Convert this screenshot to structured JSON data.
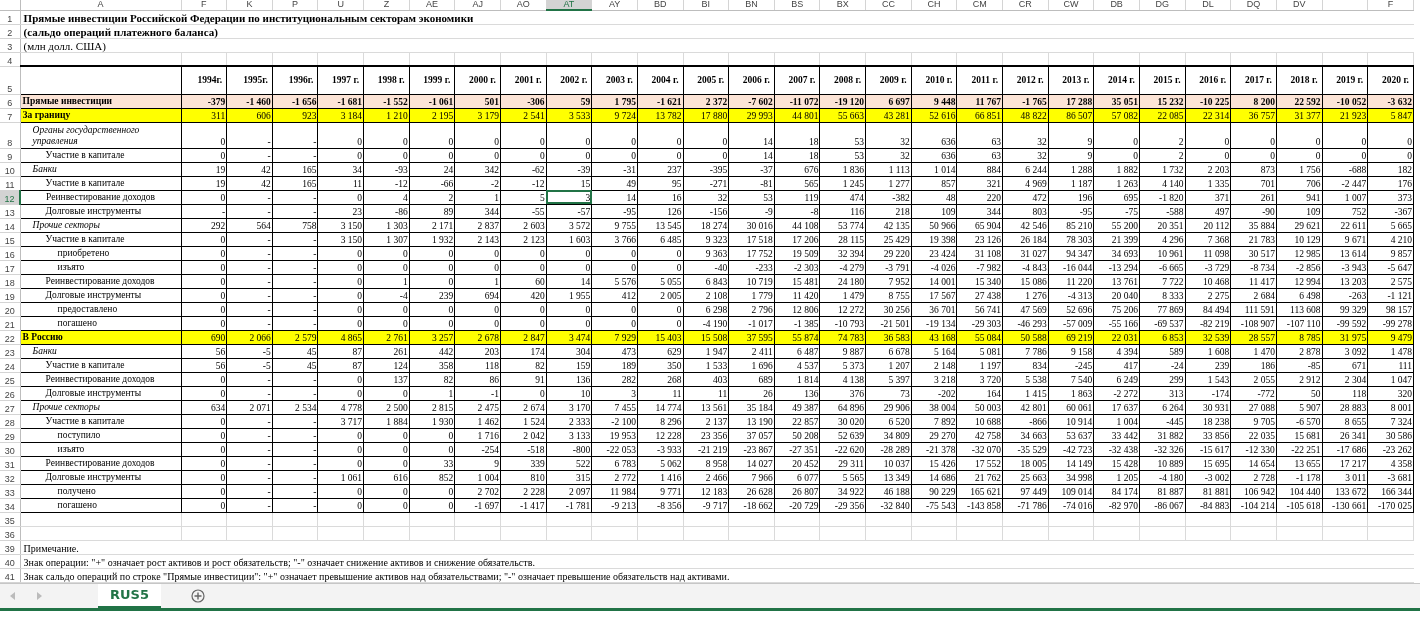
{
  "label_column_letter": "A",
  "columns": [
    {
      "letter": "F",
      "year": "1994г.",
      "selected": false
    },
    {
      "letter": "K",
      "year": "1995г.",
      "selected": false
    },
    {
      "letter": "P",
      "year": "1996г.",
      "selected": false
    },
    {
      "letter": "U",
      "year": "1997 г.",
      "selected": false
    },
    {
      "letter": "Z",
      "year": "1998 г.",
      "selected": false
    },
    {
      "letter": "AE",
      "year": "1999 г.",
      "selected": false
    },
    {
      "letter": "AJ",
      "year": "2000 г.",
      "selected": false
    },
    {
      "letter": "AO",
      "year": "2001 г.",
      "selected": false
    },
    {
      "letter": "AT",
      "year": "2002 г.",
      "selected": true
    },
    {
      "letter": "AY",
      "year": "2003 г.",
      "selected": false
    },
    {
      "letter": "BD",
      "year": "2004 г.",
      "selected": false
    },
    {
      "letter": "BI",
      "year": "2005 г.",
      "selected": false
    },
    {
      "letter": "BN",
      "year": "2006 г.",
      "selected": false
    },
    {
      "letter": "BS",
      "year": "2007 г.",
      "selected": false
    },
    {
      "letter": "BX",
      "year": "2008 г.",
      "selected": false
    },
    {
      "letter": "CC",
      "year": "2009 г.",
      "selected": false
    },
    {
      "letter": "CH",
      "year": "2010 г.",
      "selected": false
    },
    {
      "letter": "CM",
      "year": "2011 г.",
      "selected": false
    },
    {
      "letter": "CR",
      "year": "2012 г.",
      "selected": false
    },
    {
      "letter": "CW",
      "year": "2013 г.",
      "selected": false
    },
    {
      "letter": "DB",
      "year": "2014 г.",
      "selected": false
    },
    {
      "letter": "DG",
      "year": "2015 г.",
      "selected": false
    },
    {
      "letter": "DL",
      "year": "2016 г.",
      "selected": false
    },
    {
      "letter": "DQ",
      "year": "2017 г.",
      "selected": false
    },
    {
      "letter": "DV",
      "year": "2018 г.",
      "selected": false
    },
    {
      "year": "2019 г.",
      "selected": false
    },
    {
      "letter": "F",
      "year": "2020 г.",
      "selected": false
    }
  ],
  "rows": [
    {
      "number": "1",
      "kind": "title",
      "bold": true,
      "text": "Прямые инвестиции Российской Федерации по институциональным секторам экономики",
      "selected": false
    },
    {
      "number": "2",
      "kind": "title",
      "bold": true,
      "text": "(сальдо операций платежного баланса)",
      "selected": false
    },
    {
      "number": "3",
      "kind": "title",
      "bold": false,
      "text": "(млн долл. США)",
      "selected": false
    },
    {
      "number": "4",
      "kind": "blank",
      "selected": false
    },
    {
      "number": "5",
      "kind": "header",
      "selected": false
    },
    {
      "number": "6",
      "kind": "total",
      "label": "Прямые инвестиции",
      "selected": false,
      "values": [
        "-379",
        "-1 460",
        "-1 656",
        "-1 681",
        "-1 552",
        "-1 061",
        "501",
        "-306",
        "59",
        "1 795",
        "-1 621",
        "2 372",
        "-7 602",
        "-11 072",
        "-19 120",
        "6 697",
        "9 448",
        "11 767",
        "-1 765",
        "17 288",
        "35 051",
        "15 232",
        "-10 225",
        "8 200",
        "22 592",
        "-10 052",
        "-3 632"
      ]
    },
    {
      "number": "7",
      "kind": "region",
      "label": "За границу",
      "selected": false,
      "values": [
        "311",
        "606",
        "923",
        "3 184",
        "1 210",
        "2 195",
        "3 179",
        "2 541",
        "3 533",
        "9 724",
        "13 782",
        "17 880",
        "29 993",
        "44 801",
        "55 663",
        "43 281",
        "52 616",
        "66 851",
        "48 822",
        "86 507",
        "57 082",
        "22 085",
        "22 314",
        "36 757",
        "31 377",
        "21 923",
        "5 847"
      ]
    },
    {
      "number": "8",
      "kind": "sector",
      "label": "Органы государственного управления",
      "selected": false,
      "values": [
        "0",
        "-",
        "-",
        "0",
        "0",
        "0",
        "0",
        "0",
        "0",
        "0",
        "0",
        "0",
        "14",
        "18",
        "53",
        "32",
        "636",
        "63",
        "32",
        "9",
        "0",
        "2",
        "0",
        "0",
        "0",
        "0",
        "0"
      ]
    },
    {
      "number": "9",
      "kind": "item",
      "label": "Участие в капитале",
      "selected": false,
      "values": [
        "0",
        "-",
        "-",
        "0",
        "0",
        "0",
        "0",
        "0",
        "0",
        "0",
        "0",
        "0",
        "14",
        "18",
        "53",
        "32",
        "636",
        "63",
        "32",
        "9",
        "0",
        "2",
        "0",
        "0",
        "0",
        "0",
        "0"
      ]
    },
    {
      "number": "10",
      "kind": "sector",
      "label": "Банки",
      "selected": false,
      "values": [
        "19",
        "42",
        "165",
        "34",
        "-93",
        "24",
        "342",
        "-62",
        "-39",
        "-31",
        "237",
        "-395",
        "-37",
        "676",
        "1 836",
        "1 113",
        "1 014",
        "884",
        "6 244",
        "1 288",
        "1 882",
        "1 732",
        "2 203",
        "873",
        "1 756",
        "-688",
        "182"
      ]
    },
    {
      "number": "11",
      "kind": "item",
      "label": "Участие в капитале",
      "selected": false,
      "values": [
        "19",
        "42",
        "165",
        "11",
        "-12",
        "-66",
        "-2",
        "-12",
        "15",
        "49",
        "95",
        "-271",
        "-81",
        "565",
        "1 245",
        "1 277",
        "857",
        "321",
        "4 969",
        "1 187",
        "1 263",
        "4 140",
        "1 335",
        "701",
        "706",
        "-2 447",
        "176"
      ]
    },
    {
      "number": "12",
      "kind": "item",
      "label": "Реинвестирование доходов",
      "selected": true,
      "values": [
        "0",
        "-",
        "-",
        "0",
        "4",
        "2",
        "1",
        "5",
        "3",
        "14",
        "16",
        "32",
        "53",
        "119",
        "474",
        "-382",
        "48",
        "220",
        "472",
        "196",
        "695",
        "-1 820",
        "371",
        "261",
        "941",
        "1 007",
        "373"
      ]
    },
    {
      "number": "13",
      "kind": "item",
      "label": "Долговые инструменты",
      "selected": false,
      "values": [
        "-",
        "-",
        "-",
        "23",
        "-86",
        "89",
        "344",
        "-55",
        "-57",
        "-95",
        "126",
        "-156",
        "-9",
        "-8",
        "116",
        "218",
        "109",
        "344",
        "803",
        "-95",
        "-75",
        "-588",
        "497",
        "-90",
        "109",
        "752",
        "-367"
      ]
    },
    {
      "number": "14",
      "kind": "sector",
      "label": "Прочие секторы",
      "selected": false,
      "values": [
        "292",
        "564",
        "758",
        "3 150",
        "1 303",
        "2 171",
        "2 837",
        "2 603",
        "3 572",
        "9 755",
        "13 545",
        "18 274",
        "30 016",
        "44 108",
        "53 774",
        "42 135",
        "50 966",
        "65 904",
        "42 546",
        "85 210",
        "55 200",
        "20 351",
        "20 112",
        "35 884",
        "29 621",
        "22 611",
        "5 665"
      ]
    },
    {
      "number": "15",
      "kind": "item",
      "label": "Участие в капитале",
      "selected": false,
      "values": [
        "0",
        "-",
        "-",
        "3 150",
        "1 307",
        "1 932",
        "2 143",
        "2 123",
        "1 603",
        "3 766",
        "6 485",
        "9 323",
        "17 518",
        "17 206",
        "28 115",
        "25 429",
        "19 398",
        "23 126",
        "26 184",
        "78 303",
        "21 399",
        "4 296",
        "7 368",
        "21 783",
        "10 129",
        "9 671",
        "4 210"
      ]
    },
    {
      "number": "16",
      "kind": "subitem",
      "label": "приобретено",
      "selected": false,
      "values": [
        "0",
        "-",
        "-",
        "0",
        "0",
        "0",
        "0",
        "0",
        "0",
        "0",
        "0",
        "9 363",
        "17 752",
        "19 509",
        "32 394",
        "29 220",
        "23 424",
        "31 108",
        "31 027",
        "94 347",
        "34 693",
        "10 961",
        "11 098",
        "30 517",
        "12 985",
        "13 614",
        "9 857"
      ]
    },
    {
      "number": "17",
      "kind": "subitem",
      "label": "изъято",
      "selected": false,
      "values": [
        "0",
        "-",
        "-",
        "0",
        "0",
        "0",
        "0",
        "0",
        "0",
        "0",
        "0",
        "-40",
        "-233",
        "-2 303",
        "-4 279",
        "-3 791",
        "-4 026",
        "-7 982",
        "-4 843",
        "-16 044",
        "-13 294",
        "-6 665",
        "-3 729",
        "-8 734",
        "-2 856",
        "-3 943",
        "-5 647"
      ]
    },
    {
      "number": "18",
      "kind": "item",
      "label": "Реинвестирование доходов",
      "selected": false,
      "values": [
        "0",
        "-",
        "-",
        "0",
        "1",
        "0",
        "1",
        "60",
        "14",
        "5 576",
        "5 055",
        "6 843",
        "10 719",
        "15 481",
        "24 180",
        "7 952",
        "14 001",
        "15 340",
        "15 086",
        "11 220",
        "13 761",
        "7 722",
        "10 468",
        "11 417",
        "12 994",
        "13 203",
        "2 575"
      ]
    },
    {
      "number": "19",
      "kind": "item",
      "label": "Долговые инструменты",
      "selected": false,
      "values": [
        "0",
        "-",
        "-",
        "0",
        "-4",
        "239",
        "694",
        "420",
        "1 955",
        "412",
        "2 005",
        "2 108",
        "1 779",
        "11 420",
        "1 479",
        "8 755",
        "17 567",
        "27 438",
        "1 276",
        "-4 313",
        "20 040",
        "8 333",
        "2 275",
        "2 684",
        "6 498",
        "-263",
        "-1 121"
      ]
    },
    {
      "number": "20",
      "kind": "subitem",
      "label": "предоставлено",
      "selected": false,
      "values": [
        "0",
        "-",
        "-",
        "0",
        "0",
        "0",
        "0",
        "0",
        "0",
        "0",
        "0",
        "6 298",
        "2 796",
        "12 806",
        "12 272",
        "30 256",
        "36 701",
        "56 741",
        "47 569",
        "52 696",
        "75 206",
        "77 869",
        "84 494",
        "111 591",
        "113 608",
        "99 329",
        "98 157"
      ]
    },
    {
      "number": "21",
      "kind": "subitem",
      "label": "погашено",
      "selected": false,
      "values": [
        "0",
        "-",
        "-",
        "0",
        "0",
        "0",
        "0",
        "0",
        "0",
        "0",
        "0",
        "-4 190",
        "-1 017",
        "-1 385",
        "-10 793",
        "-21 501",
        "-19 134",
        "-29 303",
        "-46 293",
        "-57 009",
        "-55 166",
        "-69 537",
        "-82 219",
        "-108 907",
        "-107 110",
        "-99 592",
        "-99 278"
      ]
    },
    {
      "number": "22",
      "kind": "region",
      "label": "В Россию",
      "selected": false,
      "values": [
        "690",
        "2 066",
        "2 579",
        "4 865",
        "2 761",
        "3 257",
        "2 678",
        "2 847",
        "3 474",
        "7 929",
        "15 403",
        "15 508",
        "37 595",
        "55 874",
        "74 783",
        "36 583",
        "43 168",
        "55 084",
        "50 588",
        "69 219",
        "22 031",
        "6 853",
        "32 539",
        "28 557",
        "8 785",
        "31 975",
        "9 479"
      ]
    },
    {
      "number": "23",
      "kind": "sector",
      "label": "Банки",
      "selected": false,
      "values": [
        "56",
        "-5",
        "45",
        "87",
        "261",
        "442",
        "203",
        "174",
        "304",
        "473",
        "629",
        "1 947",
        "2 411",
        "6 487",
        "9 887",
        "6 678",
        "5 164",
        "5 081",
        "7 786",
        "9 158",
        "4 394",
        "589",
        "1 608",
        "1 470",
        "2 878",
        "3 092",
        "1 478"
      ]
    },
    {
      "number": "24",
      "kind": "item",
      "label": "Участие в капитале",
      "selected": false,
      "values": [
        "56",
        "-5",
        "45",
        "87",
        "124",
        "358",
        "118",
        "82",
        "159",
        "189",
        "350",
        "1 533",
        "1 696",
        "4 537",
        "5 373",
        "1 207",
        "2 148",
        "1 197",
        "834",
        "-245",
        "417",
        "-24",
        "239",
        "186",
        "-85",
        "671",
        "111"
      ]
    },
    {
      "number": "25",
      "kind": "item",
      "label": "Реинвестирование доходов",
      "selected": false,
      "values": [
        "0",
        "-",
        "-",
        "0",
        "137",
        "82",
        "86",
        "91",
        "136",
        "282",
        "268",
        "403",
        "689",
        "1 814",
        "4 138",
        "5 397",
        "3 218",
        "3 720",
        "5 538",
        "7 540",
        "6 249",
        "299",
        "1 543",
        "2 055",
        "2 912",
        "2 304",
        "1 047"
      ]
    },
    {
      "number": "26",
      "kind": "item",
      "label": "Долговые инструменты",
      "selected": false,
      "values": [
        "0",
        "-",
        "-",
        "0",
        "0",
        "1",
        "-1",
        "0",
        "10",
        "3",
        "11",
        "11",
        "26",
        "136",
        "376",
        "73",
        "-202",
        "164",
        "1 415",
        "1 863",
        "-2 272",
        "313",
        "-174",
        "-772",
        "50",
        "118",
        "320"
      ]
    },
    {
      "number": "27",
      "kind": "sector",
      "label": "Прочие секторы",
      "selected": false,
      "values": [
        "634",
        "2 071",
        "2 534",
        "4 778",
        "2 500",
        "2 815",
        "2 475",
        "2 674",
        "3 170",
        "7 455",
        "14 774",
        "13 561",
        "35 184",
        "49 387",
        "64 896",
        "29 906",
        "38 004",
        "50 003",
        "42 801",
        "60 061",
        "17 637",
        "6 264",
        "30 931",
        "27 088",
        "5 907",
        "28 883",
        "8 001"
      ]
    },
    {
      "number": "28",
      "kind": "item",
      "label": "Участие в капитале",
      "selected": false,
      "values": [
        "0",
        "-",
        "-",
        "3 717",
        "1 884",
        "1 930",
        "1 462",
        "1 524",
        "2 333",
        "-2 100",
        "8 296",
        "2 137",
        "13 190",
        "22 857",
        "30 020",
        "6 520",
        "7 892",
        "10 688",
        "-866",
        "10 914",
        "1 004",
        "-445",
        "18 238",
        "9 705",
        "-6 570",
        "8 655",
        "7 324"
      ]
    },
    {
      "number": "29",
      "kind": "subitem",
      "label": "поступило",
      "selected": false,
      "values": [
        "0",
        "-",
        "-",
        "0",
        "0",
        "0",
        "1 716",
        "2 042",
        "3 133",
        "19 953",
        "12 228",
        "23 356",
        "37 057",
        "50 208",
        "52 639",
        "34 809",
        "29 270",
        "42 758",
        "34 663",
        "53 637",
        "33 442",
        "31 882",
        "33 856",
        "22 035",
        "15 681",
        "26 341",
        "30 586"
      ]
    },
    {
      "number": "30",
      "kind": "subitem",
      "label": "изъято",
      "selected": false,
      "values": [
        "0",
        "-",
        "-",
        "0",
        "0",
        "0",
        "-254",
        "-518",
        "-800",
        "-22 053",
        "-3 933",
        "-21 219",
        "-23 867",
        "-27 351",
        "-22 620",
        "-28 289",
        "-21 378",
        "-32 070",
        "-35 529",
        "-42 723",
        "-32 438",
        "-32 326",
        "-15 617",
        "-12 330",
        "-22 251",
        "-17 686",
        "-23 262"
      ]
    },
    {
      "number": "31",
      "kind": "item",
      "label": "Реинвестирование доходов",
      "selected": false,
      "values": [
        "0",
        "-",
        "-",
        "0",
        "0",
        "33",
        "9",
        "339",
        "522",
        "6 783",
        "5 062",
        "8 958",
        "14 027",
        "20 452",
        "29 311",
        "10 037",
        "15 426",
        "17 552",
        "18 005",
        "14 149",
        "15 428",
        "10 889",
        "15 695",
        "14 654",
        "13 655",
        "17 217",
        "4 358"
      ]
    },
    {
      "number": "32",
      "kind": "item",
      "label": "Долговые инструменты",
      "selected": false,
      "values": [
        "0",
        "-",
        "-",
        "1 061",
        "616",
        "852",
        "1 004",
        "810",
        "315",
        "2 772",
        "1 416",
        "2 466",
        "7 966",
        "6 077",
        "5 565",
        "13 349",
        "14 686",
        "21 762",
        "25 663",
        "34 998",
        "1 205",
        "-4 180",
        "-3 002",
        "2 728",
        "-1 178",
        "3 011",
        "-3 681"
      ]
    },
    {
      "number": "33",
      "kind": "subitem",
      "label": "получено",
      "selected": false,
      "values": [
        "0",
        "-",
        "-",
        "0",
        "0",
        "0",
        "2 702",
        "2 228",
        "2 097",
        "11 984",
        "9 771",
        "12 183",
        "26 628",
        "26 807",
        "34 922",
        "46 188",
        "90 229",
        "165 621",
        "97 449",
        "109 014",
        "84 174",
        "81 887",
        "81 881",
        "106 942",
        "104 440",
        "133 672",
        "166 344"
      ]
    },
    {
      "number": "34",
      "kind": "subitem",
      "label": "погашено",
      "selected": false,
      "values": [
        "0",
        "-",
        "-",
        "0",
        "0",
        "0",
        "-1 697",
        "-1 417",
        "-1 781",
        "-9 213",
        "-8 356",
        "-9 717",
        "-18 662",
        "-20 729",
        "-29 356",
        "-32 840",
        "-75 543",
        "-143 858",
        "-71 786",
        "-74 016",
        "-82 970",
        "-86 067",
        "-84 883",
        "-104 214",
        "-105 618",
        "-130 661",
        "-170 025"
      ]
    },
    {
      "number": "35",
      "kind": "blank",
      "selected": false
    },
    {
      "number": "36",
      "kind": "blank",
      "selected": false
    },
    {
      "number": "39",
      "kind": "note",
      "text": "Примечание.",
      "selected": false
    },
    {
      "number": "40",
      "kind": "note",
      "text": "Знак операции: \"+\" означает рост активов и рост обязательств; \"-\" означает снижение активов и снижение обязательств.",
      "selected": false
    },
    {
      "number": "41",
      "kind": "note",
      "text": "Знак сальдо операций по строке \"Прямые инвестиции\": \"+\" означает превышение активов над обязательствами; \"-\" означает превышение обязательств над активами.",
      "selected": false
    }
  ],
  "sheet_tabs": [
    {
      "label": "RUS5",
      "selected": true
    }
  ]
}
